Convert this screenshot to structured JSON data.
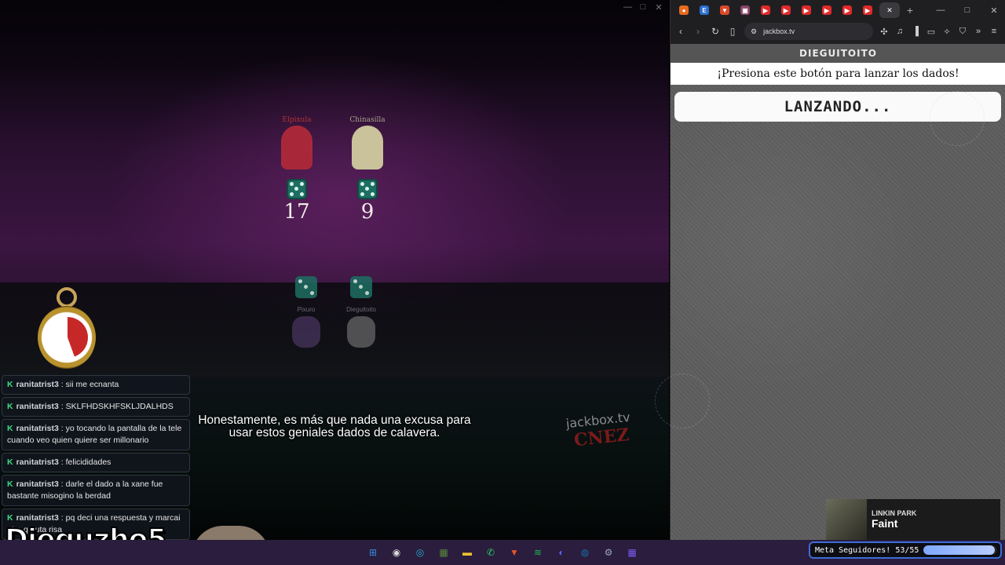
{
  "game": {
    "players_top": [
      {
        "name": "Elpixula",
        "score": "17",
        "name_color": "#b33232",
        "avatar_color": "#a8283a"
      },
      {
        "name": "Chinasilla",
        "score": "9",
        "name_color": "#a6a08a",
        "avatar_color": "#c9c29b"
      }
    ],
    "players_bottom": [
      {
        "name": "Pixuro",
        "avatar_color": "#6a4a8a"
      },
      {
        "name": "Dieguitoito",
        "avatar_color": "#9a9a9a"
      }
    ],
    "subtitle_line1": "Honestamente, es más que nada una excusa para",
    "subtitle_line2": "usar estos geniales dados de calavera.",
    "watermark_site": "jackbox.tv",
    "watermark_code": "CNEZ",
    "window_controls": [
      "—",
      "□",
      "✕"
    ]
  },
  "chat": [
    {
      "user": "ranitatrist3",
      "text": "sii me ecnanta"
    },
    {
      "user": "ranitatrist3",
      "text": "SKLFHDSKHFSKLJDALHDS"
    },
    {
      "user": "ranitatrist3",
      "text": "yo tocando la pantalla de la tele cuando veo quien quiere ser millonario"
    },
    {
      "user": "ranitatrist3",
      "text": "felicididades"
    },
    {
      "user": "ranitatrist3",
      "text": "darle el dado a la xane fue bastante misogino la berdad"
    },
    {
      "user": "ranitatrist3",
      "text": "pq deci una respuesta y marcai otra q puta risa"
    }
  ],
  "chat_badge": "K",
  "streamer_name": "Dieguzho5",
  "browser": {
    "url": "jackbox.tv",
    "window_controls": [
      "—",
      "□",
      "✕"
    ],
    "new_tab": "+",
    "tab_icons": [
      {
        "icon": "firefox-icon",
        "color": "#e66a1f",
        "glyph": "●"
      },
      {
        "icon": "e-icon",
        "color": "#2c6fcf",
        "glyph": "E"
      },
      {
        "icon": "shield-icon",
        "color": "#d94a2a",
        "glyph": "▼"
      },
      {
        "icon": "image-icon",
        "color": "#884466",
        "glyph": "▣"
      },
      {
        "icon": "youtube-icon",
        "color": "#e02a2a",
        "glyph": "▶"
      },
      {
        "icon": "youtube-icon",
        "color": "#e02a2a",
        "glyph": "▶"
      },
      {
        "icon": "youtube-icon",
        "color": "#e02a2a",
        "glyph": "▶"
      },
      {
        "icon": "youtube-icon",
        "color": "#e02a2a",
        "glyph": "▶"
      },
      {
        "icon": "youtube-icon",
        "color": "#e02a2a",
        "glyph": "▶"
      },
      {
        "icon": "youtube-icon",
        "color": "#e02a2a",
        "glyph": "▶"
      }
    ],
    "active_tab_close": "✕"
  },
  "jackbox": {
    "player_name": "DIEGUITOITO",
    "prompt": "¡Presiona este botón para lanzar los dados!",
    "button_label": "LANZANDO..."
  },
  "now_playing": {
    "artist": "LINKIN PARK",
    "song": "Faint"
  },
  "goal": {
    "label": "Meta Seguidores! 53/55",
    "current": 53,
    "target": 55
  },
  "taskbar": [
    {
      "name": "windows-start-icon",
      "glyph": "⊞",
      "color": "#3a8ee6"
    },
    {
      "name": "chrome-icon",
      "glyph": "◉",
      "color": "#d9d9d9"
    },
    {
      "name": "edge-icon",
      "glyph": "◎",
      "color": "#2fa9d6"
    },
    {
      "name": "minecraft-icon",
      "glyph": "▦",
      "color": "#5a8a3a"
    },
    {
      "name": "file-explorer-icon",
      "glyph": "▬",
      "color": "#f2c230"
    },
    {
      "name": "whatsapp-icon",
      "glyph": "✆",
      "color": "#25d366"
    },
    {
      "name": "brave-icon",
      "glyph": "▼",
      "color": "#e8552a"
    },
    {
      "name": "spotify-icon",
      "glyph": "≋",
      "color": "#1db954"
    },
    {
      "name": "discord-icon",
      "glyph": "◐",
      "color": "#5865f2"
    },
    {
      "name": "steam-icon",
      "glyph": "◍",
      "color": "#1b6fa8"
    },
    {
      "name": "settings-icon",
      "glyph": "⚙",
      "color": "#9aa7b8"
    },
    {
      "name": "apps-grid-icon",
      "glyph": "▦",
      "color": "#7a5af0"
    }
  ]
}
